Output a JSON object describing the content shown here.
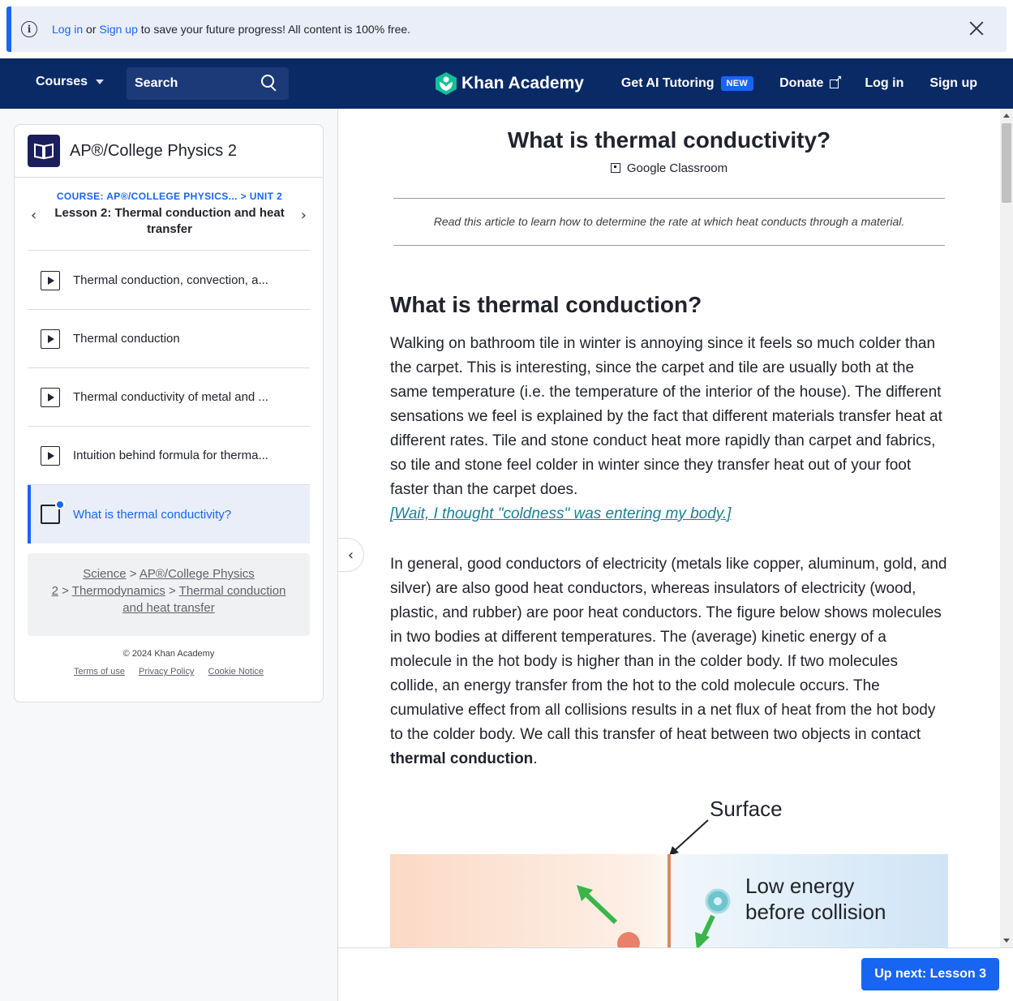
{
  "banner": {
    "login": "Log in",
    "or": "or",
    "signup": "Sign up",
    "rest": "to save your future progress! All content is 100% free."
  },
  "header": {
    "courses": "Courses",
    "search_placeholder": "Search",
    "logo": "Khan Academy",
    "ai_tutoring": "Get AI Tutoring",
    "new_badge": "NEW",
    "donate": "Donate",
    "login": "Log in",
    "signup": "Sign up"
  },
  "sidebar": {
    "course_title": "AP®/College Physics 2",
    "crumb": "COURSE: AP®/COLLEGE PHYSICS... > UNIT 2",
    "lesson_title": "Lesson 2: Thermal conduction and heat transfer",
    "items": [
      {
        "label": "Thermal conduction, convection, a..."
      },
      {
        "label": "Thermal conduction"
      },
      {
        "label": "Thermal conductivity of metal and ..."
      },
      {
        "label": "Intuition behind formula for therma..."
      },
      {
        "label": "What is thermal conductivity?"
      }
    ],
    "breadcrumbs": {
      "science": "Science",
      "course_part1": "AP®/College Physics",
      "course_part2": "2",
      "unit": "Thermodynamics",
      "lesson_part1": "Thermal conduction",
      "lesson_part2": "and heat transfer",
      "sep": ">"
    },
    "copyright": "© 2024 Khan Academy",
    "terms": "Terms of use",
    "privacy": "Privacy Policy",
    "cookie": "Cookie Notice"
  },
  "article": {
    "title": "What is thermal conductivity?",
    "google_classroom": "Google Classroom",
    "intro": "Read this article to learn how to determine the rate at which heat conducts through a material.",
    "h2": "What is thermal conduction?",
    "p1": "Walking on bathroom tile in winter is annoying since it feels so much colder than the carpet. This is interesting, since the carpet and tile are usually both at the same temperature (i.e. the temperature of the interior of the house). The different sensations we feel is explained by the fact that different materials transfer heat at different rates. Tile and stone conduct heat more rapidly than carpet and fabrics, so tile and stone feel colder in winter since they transfer heat out of your foot faster than the carpet does.",
    "p1_link": "[Wait, I thought \"coldness\" was entering my body.]",
    "p2_start": "In general, good conductors of electricity (metals like copper, aluminum, gold, and silver) are also good heat conductors, whereas insulators of electricity (wood, plastic, and rubber) are poor heat conductors. The figure below shows molecules in two bodies at different temperatures. The (average) kinetic energy of a molecule in the hot body is higher than in the colder body. If two molecules collide, an energy transfer from the hot to the cold molecule occurs. The cumulative effect from all collisions results in a net flux of heat from the hot body to the colder body. We call this transfer of heat between two objects in contact",
    "p2_bold": "thermal conduction",
    "p2_end": ".",
    "figure": {
      "surface": "Surface",
      "low_energy_1": "Low energy",
      "low_energy_2": "before collision"
    }
  },
  "bottom": {
    "next": "Up next: Lesson 3"
  },
  "colors": {
    "accent": "#1865f2",
    "header_bg": "#0a2a66",
    "logo_green": "#14bf96"
  }
}
